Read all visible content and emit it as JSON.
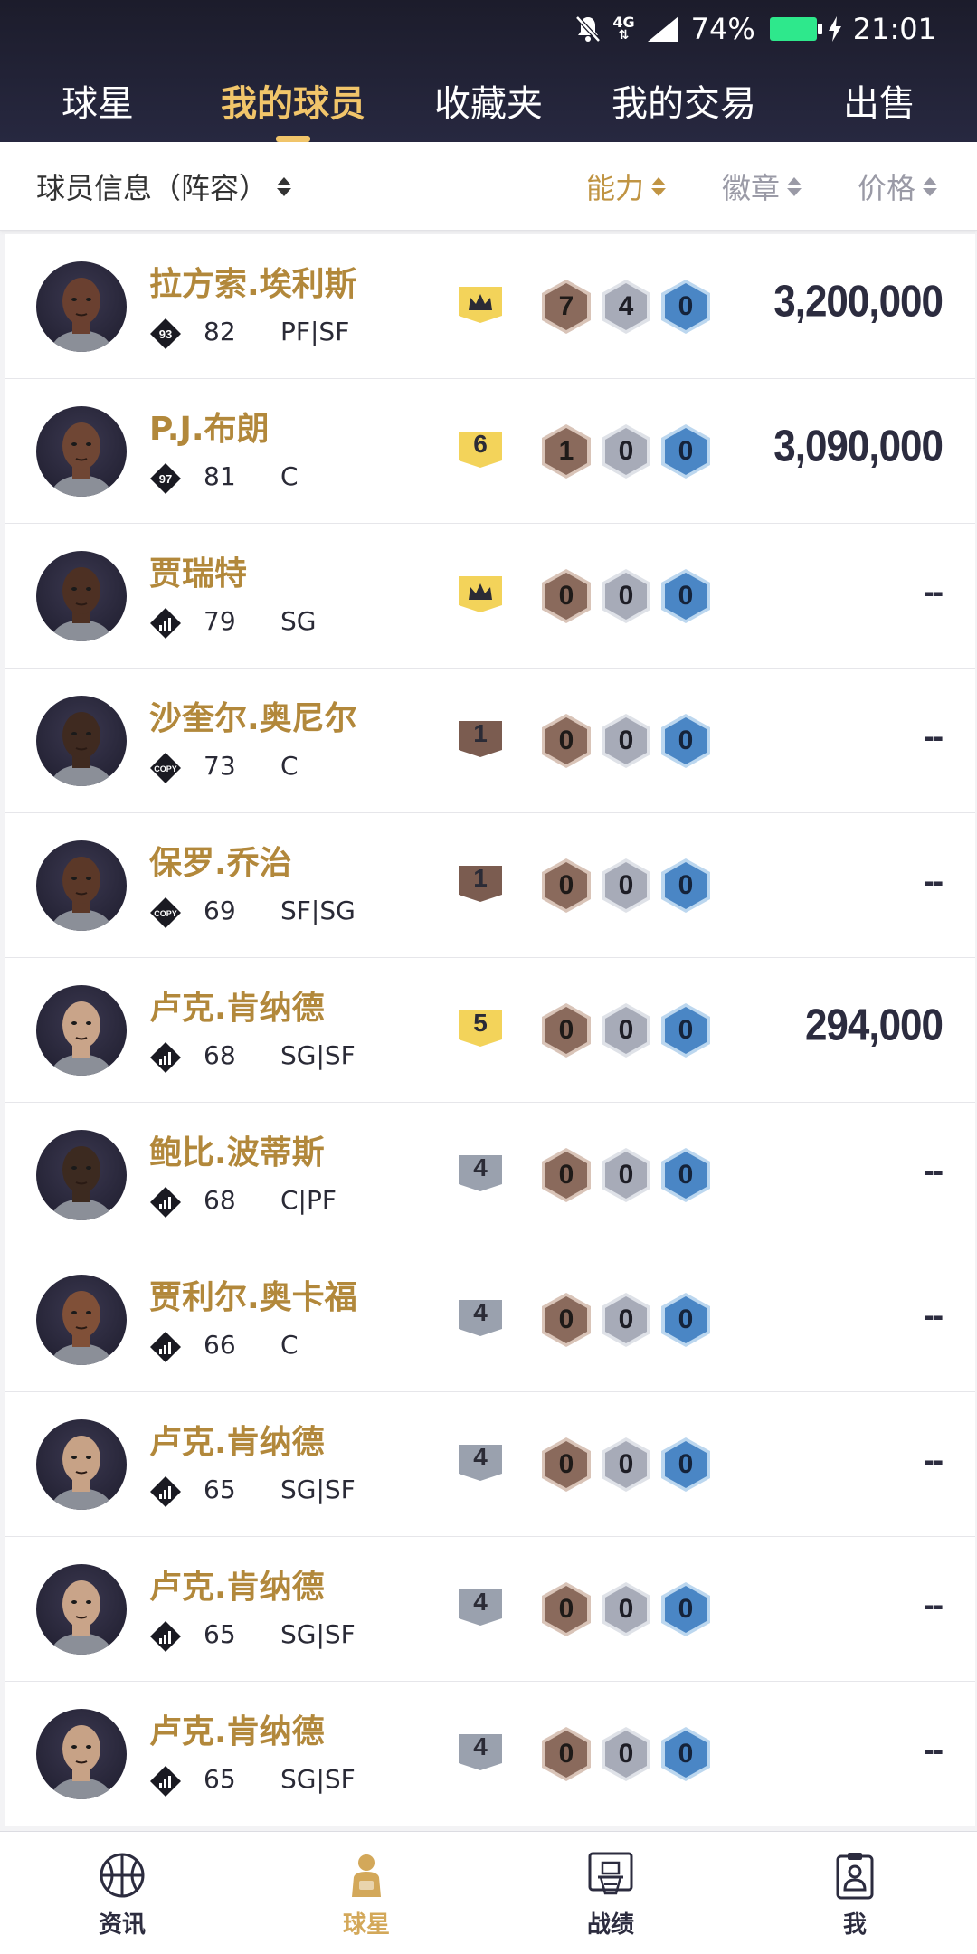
{
  "status_bar": {
    "network": "4G",
    "battery": "74%",
    "time": "21:01",
    "icons": [
      "bell-muted-icon",
      "4g-icon",
      "signal-icon",
      "battery-charging-icon"
    ]
  },
  "tabs": [
    {
      "label": "球星"
    },
    {
      "label": "我的球员",
      "active": true
    },
    {
      "label": "收藏夹"
    },
    {
      "label": "我的交易"
    },
    {
      "label": "出售"
    }
  ],
  "sort_bar": {
    "left_label": "球员信息（阵容）",
    "ability_label": "能力",
    "badge_label": "徽章",
    "price_label": "价格",
    "active_sort": "能力"
  },
  "colors": {
    "gold": "#b2883b",
    "active_tab": "#f1c56a",
    "header_bg": "#1f2030",
    "bronze": "#8a6a5c",
    "silver": "#a7abb8",
    "blue": "#4a86c5",
    "tier_yellow": "#f3d35a",
    "tier_brown": "#7b5c50",
    "tier_gray": "#9aa1ae"
  },
  "players": [
    {
      "name": "拉方索.埃利斯",
      "rating_icon": "93",
      "ovr": "82",
      "pos": "PF|SF",
      "tier": "crown",
      "tier_label": "",
      "b1": "7",
      "b2": "4",
      "b3": "0",
      "price": "3,200,000"
    },
    {
      "name": "P.J.布朗",
      "rating_icon": "97",
      "ovr": "81",
      "pos": "C",
      "tier": "yellow",
      "tier_label": "6",
      "b1": "1",
      "b2": "0",
      "b3": "0",
      "price": "3,090,000"
    },
    {
      "name": "贾瑞特",
      "rating_icon": "bars",
      "ovr": "79",
      "pos": "SG",
      "tier": "crown",
      "tier_label": "",
      "b1": "0",
      "b2": "0",
      "b3": "0",
      "price": "--"
    },
    {
      "name": "沙奎尔.奥尼尔",
      "rating_icon": "COPY",
      "ovr": "73",
      "pos": "C",
      "tier": "brown",
      "tier_label": "1",
      "b1": "0",
      "b2": "0",
      "b3": "0",
      "price": "--"
    },
    {
      "name": "保罗.乔治",
      "rating_icon": "COPY",
      "ovr": "69",
      "pos": "SF|SG",
      "tier": "brown",
      "tier_label": "1",
      "b1": "0",
      "b2": "0",
      "b3": "0",
      "price": "--"
    },
    {
      "name": "卢克.肯纳德",
      "rating_icon": "bars",
      "ovr": "68",
      "pos": "SG|SF",
      "tier": "yellow",
      "tier_label": "5",
      "b1": "0",
      "b2": "0",
      "b3": "0",
      "price": "294,000"
    },
    {
      "name": "鲍比.波蒂斯",
      "rating_icon": "bars",
      "ovr": "68",
      "pos": "C|PF",
      "tier": "gray",
      "tier_label": "4",
      "b1": "0",
      "b2": "0",
      "b3": "0",
      "price": "--"
    },
    {
      "name": "贾利尔.奥卡福",
      "rating_icon": "bars",
      "ovr": "66",
      "pos": "C",
      "tier": "gray",
      "tier_label": "4",
      "b1": "0",
      "b2": "0",
      "b3": "0",
      "price": "--"
    },
    {
      "name": "卢克.肯纳德",
      "rating_icon": "bars",
      "ovr": "65",
      "pos": "SG|SF",
      "tier": "gray",
      "tier_label": "4",
      "b1": "0",
      "b2": "0",
      "b3": "0",
      "price": "--"
    },
    {
      "name": "卢克.肯纳德",
      "rating_icon": "bars",
      "ovr": "65",
      "pos": "SG|SF",
      "tier": "gray",
      "tier_label": "4",
      "b1": "0",
      "b2": "0",
      "b3": "0",
      "price": "--"
    },
    {
      "name": "卢克.肯纳德",
      "rating_icon": "bars",
      "ovr": "65",
      "pos": "SG|SF",
      "tier": "gray",
      "tier_label": "4",
      "b1": "0",
      "b2": "0",
      "b3": "0",
      "price": "--"
    }
  ],
  "bottom_nav": [
    {
      "label": "资讯",
      "icon": "basketball-icon"
    },
    {
      "label": "球星",
      "icon": "player-icon",
      "active": true
    },
    {
      "label": "战绩",
      "icon": "hoop-icon"
    },
    {
      "label": "我",
      "icon": "profile-card-icon"
    }
  ]
}
